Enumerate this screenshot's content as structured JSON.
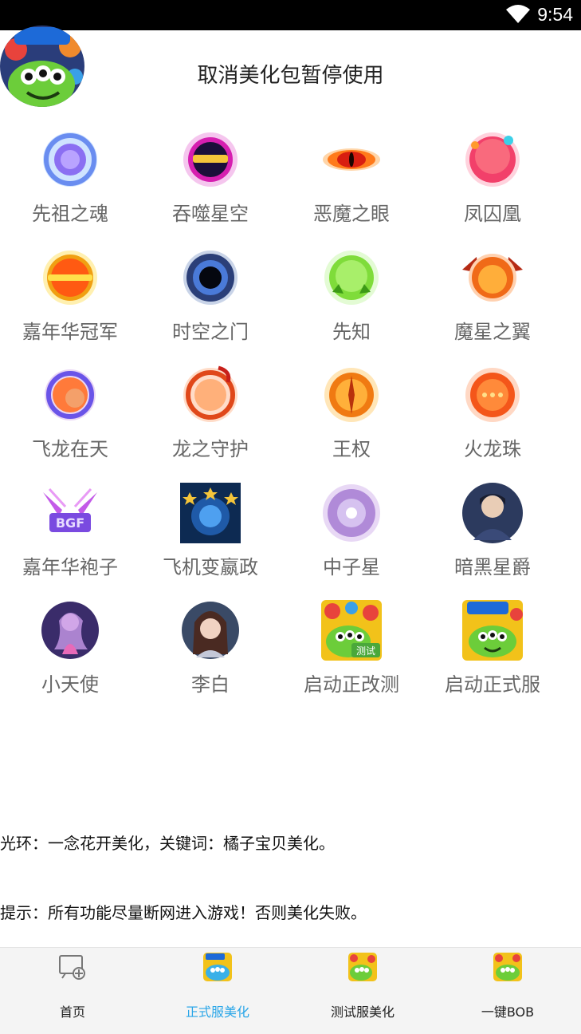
{
  "status_bar": {
    "time": "9:54"
  },
  "header": {
    "title": "取消美化包暂停使用",
    "avatar_icon": "big-eye-monster-app-icon"
  },
  "grid": {
    "rows": [
      [
        {
          "label": "先祖之魂",
          "icon": "ancestor-soul-halo-icon"
        },
        {
          "label": "吞噬星空",
          "icon": "devour-starry-sky-halo-icon"
        },
        {
          "label": "恶魔之眼",
          "icon": "demon-eye-halo-icon"
        },
        {
          "label": "凤囚凰",
          "icon": "phoenix-halo-icon"
        }
      ],
      [
        {
          "label": "嘉年华冠军",
          "icon": "carnival-champion-halo-icon"
        },
        {
          "label": "时空之门",
          "icon": "time-space-gate-halo-icon"
        },
        {
          "label": "先知",
          "icon": "prophet-halo-icon"
        },
        {
          "label": "魔星之翼",
          "icon": "demon-star-wings-halo-icon"
        }
      ],
      [
        {
          "label": "飞龙在天",
          "icon": "flying-dragon-halo-icon"
        },
        {
          "label": "龙之守护",
          "icon": "dragon-guard-halo-icon"
        },
        {
          "label": "王权",
          "icon": "kingship-halo-icon"
        },
        {
          "label": "火龙珠",
          "icon": "fire-dragon-pearl-halo-icon"
        }
      ],
      [
        {
          "label": "嘉年华袍子",
          "icon": "bgf-wings-logo-icon"
        },
        {
          "label": "飞机变嬴政",
          "icon": "plane-to-yingzheng-icon"
        },
        {
          "label": "中子星",
          "icon": "neutron-star-halo-icon"
        },
        {
          "label": "暗黑星爵",
          "icon": "dark-star-lord-avatar-icon"
        }
      ],
      [
        {
          "label": "小天使",
          "icon": "little-angel-avatar-icon"
        },
        {
          "label": "李白",
          "icon": "libai-avatar-icon"
        },
        {
          "label": "启动正改测",
          "icon": "test-server-app-icon",
          "badge": "测试"
        },
        {
          "label": "启动正式服",
          "icon": "official-server-app-icon"
        }
      ]
    ]
  },
  "notes": {
    "line1": "光环：一念花开美化，关键词：橘子宝贝美化。",
    "line2": "提示：所有功能尽量断网进入游戏！否则美化失败。"
  },
  "bottom_nav": {
    "items": [
      {
        "label": "首页",
        "icon": "home-monitor-icon",
        "active": false
      },
      {
        "label": "正式服美化",
        "icon": "official-server-app-icon",
        "active": true
      },
      {
        "label": "测试服美化",
        "icon": "test-server-app-icon",
        "active": false
      },
      {
        "label": "一键BOB",
        "icon": "bob-app-icon",
        "active": false
      }
    ]
  },
  "colors": {
    "active_tab": "#2aa6e8",
    "label_gray": "#666666",
    "status_bar": "#000000"
  }
}
